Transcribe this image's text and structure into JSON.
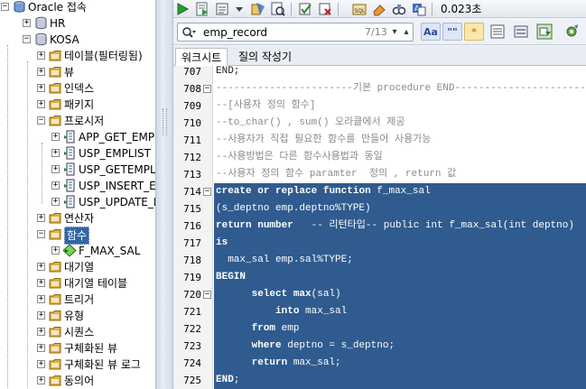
{
  "navigator": {
    "nodes": [
      {
        "label": "Oracle 접속",
        "icon": "oracle-connections-icon",
        "expander": "−"
      },
      {
        "label": "HR",
        "icon": "database-connection-icon",
        "expander": "+"
      },
      {
        "label": "KOSA",
        "icon": "database-connection-icon",
        "expander": "−"
      },
      {
        "label": "테이블(필터링됨)",
        "icon": "table-folder-icon",
        "expander": "+"
      },
      {
        "label": "뷰",
        "icon": "view-folder-icon",
        "expander": "+"
      },
      {
        "label": "인덱스",
        "icon": "index-folder-icon",
        "expander": "+"
      },
      {
        "label": "패키지",
        "icon": "package-folder-icon",
        "expander": "+"
      },
      {
        "label": "프로시저",
        "icon": "procedure-folder-icon",
        "expander": "−"
      },
      {
        "label": "APP_GET_EMPL",
        "icon": "procedure-icon",
        "expander": "+"
      },
      {
        "label": "USP_EMPLIST",
        "icon": "procedure-icon",
        "expander": "+"
      },
      {
        "label": "USP_GETEMPLI",
        "icon": "procedure-icon",
        "expander": "+"
      },
      {
        "label": "USP_INSERT_EM",
        "icon": "procedure-icon",
        "expander": "+"
      },
      {
        "label": "USP_UPDATE_E",
        "icon": "procedure-icon",
        "expander": "+"
      },
      {
        "label": "연산자",
        "icon": "operator-folder-icon",
        "expander": "+"
      },
      {
        "label": "함수",
        "icon": "function-folder-icon",
        "expander": "−"
      },
      {
        "label": "F_MAX_SAL",
        "icon": "function-icon",
        "expander": "+"
      },
      {
        "label": "대기열",
        "icon": "queue-folder-icon",
        "expander": "+"
      },
      {
        "label": "대기열 테이블",
        "icon": "queue-table-folder-icon",
        "expander": "+"
      },
      {
        "label": "트리거",
        "icon": "trigger-folder-icon",
        "expander": "+"
      },
      {
        "label": "유형",
        "icon": "type-folder-icon",
        "expander": "+"
      },
      {
        "label": "시퀀스",
        "icon": "sequence-folder-icon",
        "expander": "+"
      },
      {
        "label": "구체화된 뷰",
        "icon": "materialized-view-folder-icon",
        "expander": "+"
      },
      {
        "label": "구체화된 뷰 로그",
        "icon": "materialized-view-log-folder-icon",
        "expander": "+"
      },
      {
        "label": "동의어",
        "icon": "synonym-folder-icon",
        "expander": "+"
      }
    ]
  },
  "toolbar": {
    "buttons": [
      "run-statement-icon",
      "run-script-icon",
      "commit-icon",
      "dropdown-arrow-icon",
      "explain-plan-icon",
      "autotrace-icon",
      "commit-check-icon",
      "rollback-icon",
      "sql-history-icon",
      "eraser-icon",
      "binoculars-icon",
      "translate-icon"
    ],
    "timing": "0.023초"
  },
  "find": {
    "value": "emp_record",
    "match_count": "7/13",
    "buttons": [
      "Aa",
      "\"\"",
      "*"
    ]
  },
  "tabs": {
    "worksheet": "워크시트",
    "query_builder": "질의 작성기"
  },
  "editor": {
    "lines": [
      {
        "n": "707",
        "text": "END;",
        "fold": "",
        "sel": false,
        "comment": false
      },
      {
        "n": "708",
        "text": "-----------------------기본 procedure END-----------------------",
        "fold": "−",
        "sel": false,
        "comment": true
      },
      {
        "n": "709",
        "text": "--[사용자 정의 함수]",
        "fold": "",
        "sel": false,
        "comment": true
      },
      {
        "n": "710",
        "text": "--to_char() , sum() 오라클에서 제공",
        "fold": "",
        "sel": false,
        "comment": true
      },
      {
        "n": "711",
        "text": "--사용자가 직접 필요한 함수를 만들어 사용가능",
        "fold": "",
        "sel": false,
        "comment": true
      },
      {
        "n": "712",
        "text": "--사용방법은 다른 함수사용법과 동일",
        "fold": "",
        "sel": false,
        "comment": true
      },
      {
        "n": "713",
        "text": "--사용자 정의 함수 paramter  정의 , return 값",
        "fold": "",
        "sel": false,
        "comment": true
      },
      {
        "n": "714",
        "text": "create or replace function f_max_sal",
        "fold": "−",
        "sel": true,
        "comment": false
      },
      {
        "n": "715",
        "text": "(s_deptno emp.deptno%TYPE)",
        "fold": "",
        "sel": true,
        "comment": false
      },
      {
        "n": "716",
        "text": "return number   -- 리턴타입-- public int f_max_sal(int deptno)",
        "fold": "",
        "sel": true,
        "comment": false
      },
      {
        "n": "717",
        "text": "is",
        "fold": "",
        "sel": true,
        "comment": false
      },
      {
        "n": "718",
        "text": "  max_sal emp.sal%TYPE;",
        "fold": "",
        "sel": true,
        "comment": false
      },
      {
        "n": "719",
        "text": "BEGIN",
        "fold": "",
        "sel": true,
        "comment": false
      },
      {
        "n": "720",
        "text": "      select max(sal)",
        "fold": "−",
        "sel": true,
        "comment": false
      },
      {
        "n": "721",
        "text": "          into max_sal",
        "fold": "",
        "sel": true,
        "comment": false
      },
      {
        "n": "722",
        "text": "      from emp",
        "fold": "",
        "sel": true,
        "comment": false
      },
      {
        "n": "723",
        "text": "      where deptno = s_deptno;",
        "fold": "",
        "sel": true,
        "comment": false
      },
      {
        "n": "724",
        "text": "      return max_sal;",
        "fold": "",
        "sel": true,
        "comment": false
      },
      {
        "n": "725",
        "text": "END;",
        "fold": "",
        "sel": true,
        "comment": false
      }
    ]
  },
  "colors": {
    "selection": "#2f5b8f",
    "tree_selected": "#3465a4",
    "comment": "#8a8a8a"
  }
}
